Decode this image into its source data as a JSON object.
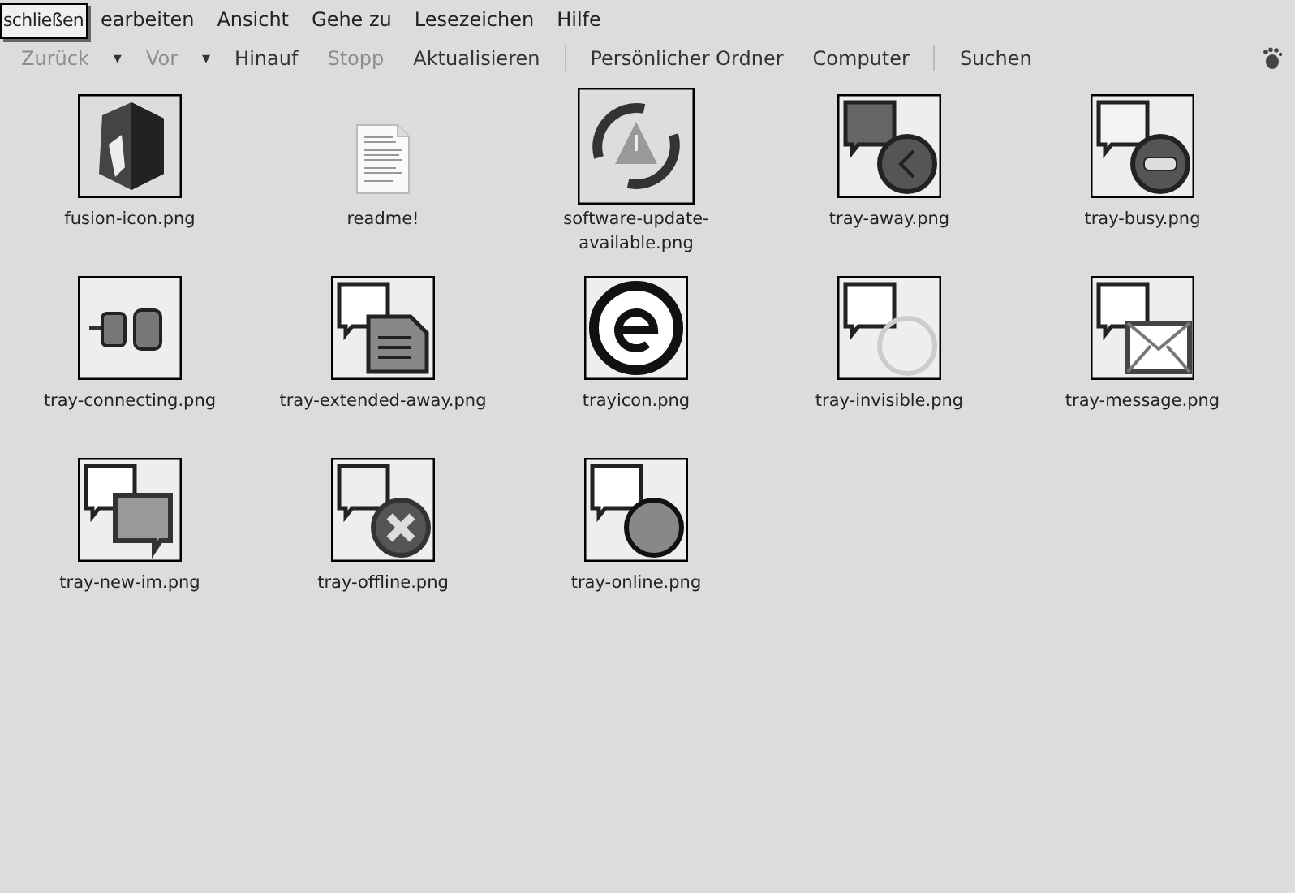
{
  "tooltip": {
    "text": "schließen"
  },
  "menu": [
    "earbeiten",
    "Ansicht",
    "Gehe zu",
    "Lesezeichen",
    "Hilfe"
  ],
  "toolbar": [
    {
      "kind": "button",
      "label": "Zurück",
      "disabled": true
    },
    {
      "kind": "dropdown",
      "label": "▾",
      "disabled": false
    },
    {
      "kind": "button",
      "label": "Vor",
      "disabled": true
    },
    {
      "kind": "dropdown",
      "label": "▾",
      "disabled": false
    },
    {
      "kind": "button",
      "label": "Hinauf",
      "disabled": false
    },
    {
      "kind": "button",
      "label": "Stopp",
      "disabled": true
    },
    {
      "kind": "button",
      "label": "Aktualisieren",
      "disabled": false
    },
    {
      "kind": "separator"
    },
    {
      "kind": "button",
      "label": "Persönlicher Ordner",
      "disabled": false
    },
    {
      "kind": "button",
      "label": "Computer",
      "disabled": false
    },
    {
      "kind": "separator"
    },
    {
      "kind": "button",
      "label": "Suchen",
      "disabled": false
    }
  ],
  "files": [
    {
      "kind": "image",
      "name": "fusion-icon.png"
    },
    {
      "kind": "document",
      "name": "readme!"
    },
    {
      "kind": "image",
      "name": "software-update-available.png"
    },
    {
      "kind": "image",
      "name": "tray-away.png"
    },
    {
      "kind": "image",
      "name": "tray-busy.png"
    },
    {
      "kind": "image",
      "name": "tray-connecting.png"
    },
    {
      "kind": "image",
      "name": "tray-extended-away.png"
    },
    {
      "kind": "image",
      "name": "trayicon.png"
    },
    {
      "kind": "image",
      "name": "tray-invisible.png"
    },
    {
      "kind": "image",
      "name": "tray-message.png"
    },
    {
      "kind": "image",
      "name": "tray-new-im.png"
    },
    {
      "kind": "image",
      "name": "tray-offline.png"
    },
    {
      "kind": "image",
      "name": "tray-online.png"
    }
  ]
}
